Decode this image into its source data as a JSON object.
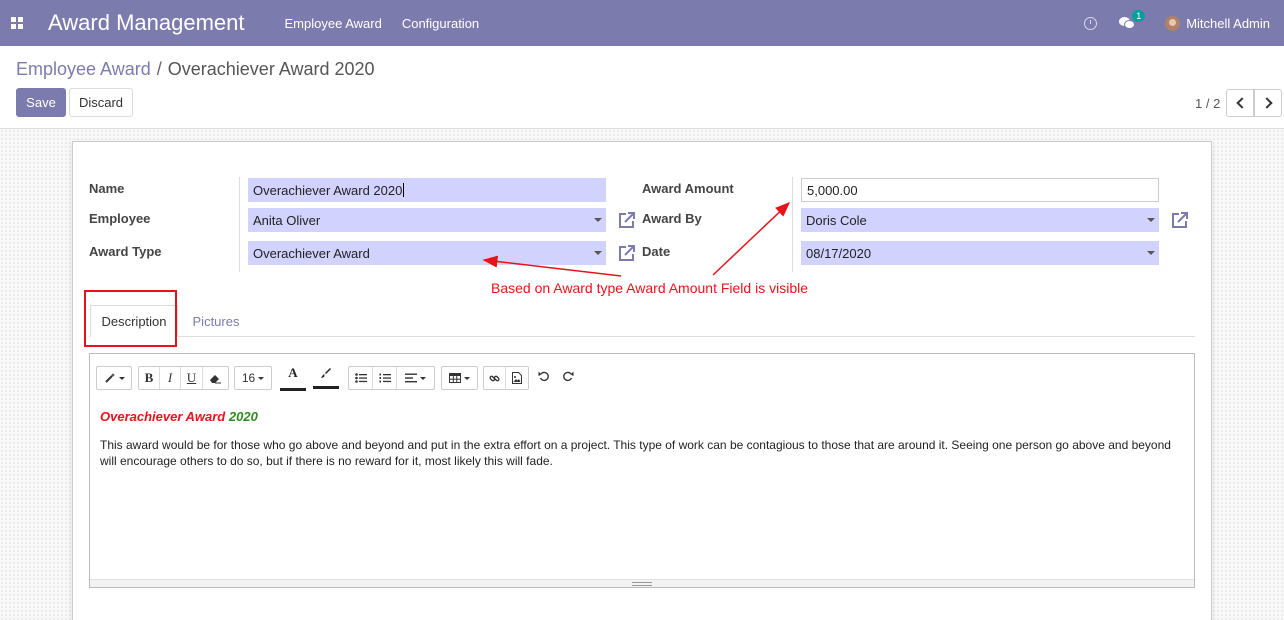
{
  "navbar": {
    "brand": "Award Management",
    "menu": [
      "Employee Award",
      "Configuration"
    ],
    "chat_count": "1",
    "user": "Mitchell Admin"
  },
  "breadcrumb": {
    "parent": "Employee Award",
    "separator": "/",
    "current": "Overachiever Award 2020"
  },
  "buttons": {
    "save": "Save",
    "discard": "Discard"
  },
  "pager": {
    "value": "1 / 2"
  },
  "form": {
    "name_label": "Name",
    "name_value": "Overachiever Award 2020",
    "employee_label": "Employee",
    "employee_value": "Anita Oliver",
    "award_type_label": "Award Type",
    "award_type_value": "Overachiever Award",
    "award_amount_label": "Award Amount",
    "award_amount_value": "5,000.00",
    "award_by_label": "Award By",
    "award_by_value": "Doris Cole",
    "date_label": "Date",
    "date_value": "08/17/2020"
  },
  "annotation": "Based on Award type Award Amount Field is visible",
  "tabs": [
    "Description",
    "Pictures"
  ],
  "editor": {
    "font_size": "16",
    "title_part1": "Overachiever Award",
    "title_part2": "2020",
    "body": "This award would be for those who go above and beyond and put in the extra effort on a project. This type of work can be contagious to those that are around it. Seeing one person go above and beyond will encourage others to do so, but if there is no reward for it, most likely this will fade."
  },
  "colors": {
    "brand": "#7c7bad",
    "required_field": "#d2d2ff",
    "annotation": "#e8131a"
  }
}
